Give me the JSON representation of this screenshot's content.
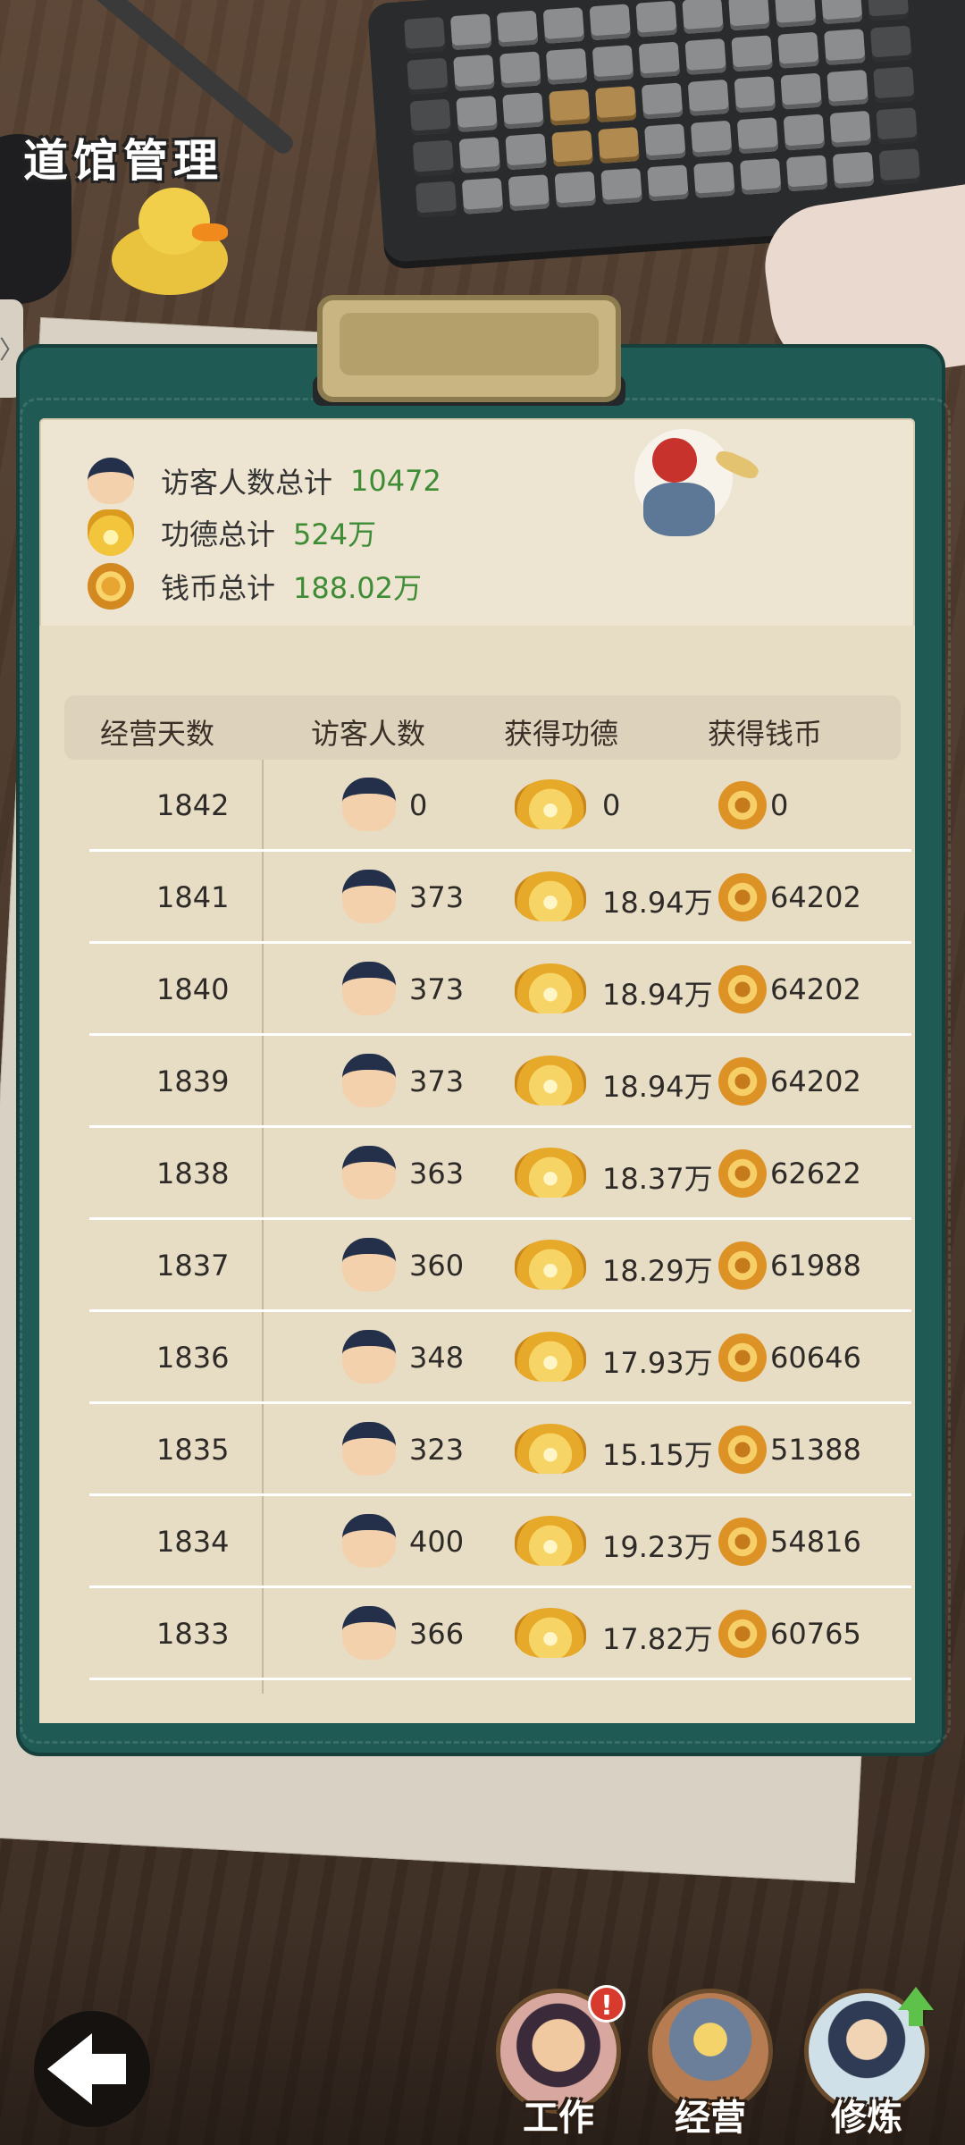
{
  "page": {
    "title": "道馆管理",
    "side_tab_glyph": "〉"
  },
  "summary": [
    {
      "icon": "visitor-face-icon",
      "label": "访客人数总计",
      "value": "10472"
    },
    {
      "icon": "lotus-merit-icon",
      "label": "功德总计",
      "value": "524万"
    },
    {
      "icon": "coin-icon",
      "label": "钱币总计",
      "value": "188.02万"
    }
  ],
  "table": {
    "headers": [
      "经营天数",
      "访客人数",
      "获得功德",
      "获得钱币"
    ],
    "rows": [
      {
        "day": "1842",
        "visitors": "0",
        "merit": "0",
        "coins": "0"
      },
      {
        "day": "1841",
        "visitors": "373",
        "merit": "18.94万",
        "coins": "64202"
      },
      {
        "day": "1840",
        "visitors": "373",
        "merit": "18.94万",
        "coins": "64202"
      },
      {
        "day": "1839",
        "visitors": "373",
        "merit": "18.94万",
        "coins": "64202"
      },
      {
        "day": "1838",
        "visitors": "363",
        "merit": "18.37万",
        "coins": "62622"
      },
      {
        "day": "1837",
        "visitors": "360",
        "merit": "18.29万",
        "coins": "61988"
      },
      {
        "day": "1836",
        "visitors": "348",
        "merit": "17.93万",
        "coins": "60646"
      },
      {
        "day": "1835",
        "visitors": "323",
        "merit": "15.15万",
        "coins": "51388"
      },
      {
        "day": "1834",
        "visitors": "400",
        "merit": "19.23万",
        "coins": "54816"
      },
      {
        "day": "1833",
        "visitors": "366",
        "merit": "17.82万",
        "coins": "60765"
      }
    ]
  },
  "nav": {
    "back_icon": "back-arrow-icon",
    "items": [
      {
        "label": "工作",
        "badge": "!"
      },
      {
        "label": "经营",
        "badge": ""
      },
      {
        "label": "修炼",
        "badge": ""
      }
    ]
  }
}
